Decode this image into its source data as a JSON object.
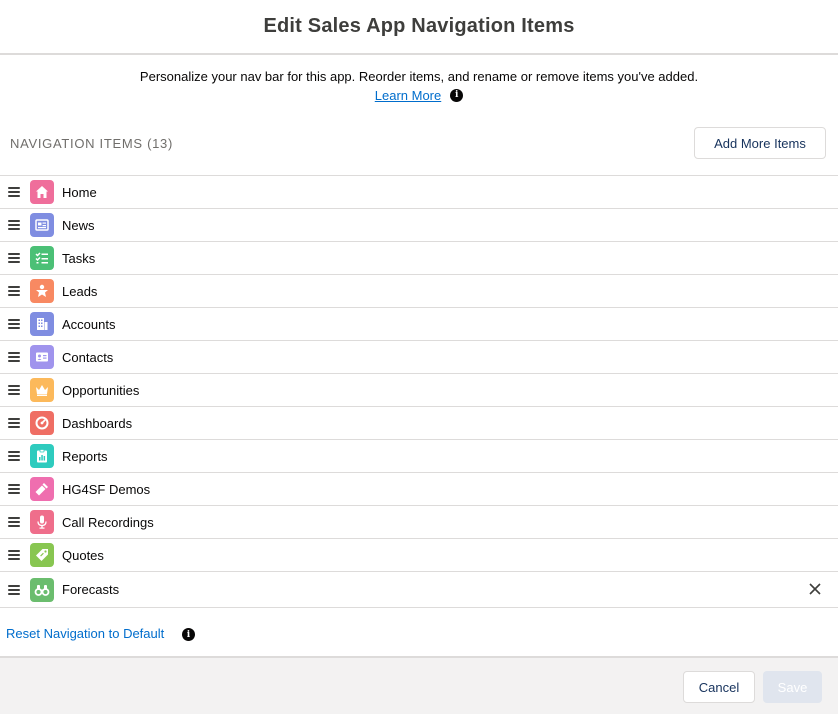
{
  "modal": {
    "title": "Edit Sales App Navigation Items"
  },
  "intro": {
    "text": "Personalize your nav bar for this app. Reorder items, and rename or remove items you've added.",
    "learn_more": "Learn More",
    "info_icon": "info-icon"
  },
  "section": {
    "label": "NAVIGATION ITEMS (13)",
    "add_button": "Add More Items"
  },
  "nav_items": [
    {
      "label": "Home",
      "icon": "home-icon",
      "color": "#ef6e9b"
    },
    {
      "label": "News",
      "icon": "news-icon",
      "color": "#7f8de1"
    },
    {
      "label": "Tasks",
      "icon": "tasks-icon",
      "color": "#4bc076"
    },
    {
      "label": "Leads",
      "icon": "lead-icon",
      "color": "#f88962"
    },
    {
      "label": "Accounts",
      "icon": "account-icon",
      "color": "#7f8de1"
    },
    {
      "label": "Contacts",
      "icon": "contact-icon",
      "color": "#a094ed"
    },
    {
      "label": "Opportunities",
      "icon": "opportunity-icon",
      "color": "#fcb95b"
    },
    {
      "label": "Dashboards",
      "icon": "dashboard-icon",
      "color": "#ef6e64"
    },
    {
      "label": "Reports",
      "icon": "report-icon",
      "color": "#2ecbbe"
    },
    {
      "label": "HG4SF Demos",
      "icon": "flashlight-icon",
      "color": "#ef6eaf"
    },
    {
      "label": "Call Recordings",
      "icon": "microphone-icon",
      "color": "#ef6e8b"
    },
    {
      "label": "Quotes",
      "icon": "quote-tag-icon",
      "color": "#88c651"
    },
    {
      "label": "Forecasts",
      "icon": "forecast-binoculars-icon",
      "color": "#6bbd6e",
      "removable": true
    }
  ],
  "reset": {
    "label": "Reset Navigation to Default"
  },
  "footer": {
    "cancel": "Cancel",
    "save": "Save"
  }
}
